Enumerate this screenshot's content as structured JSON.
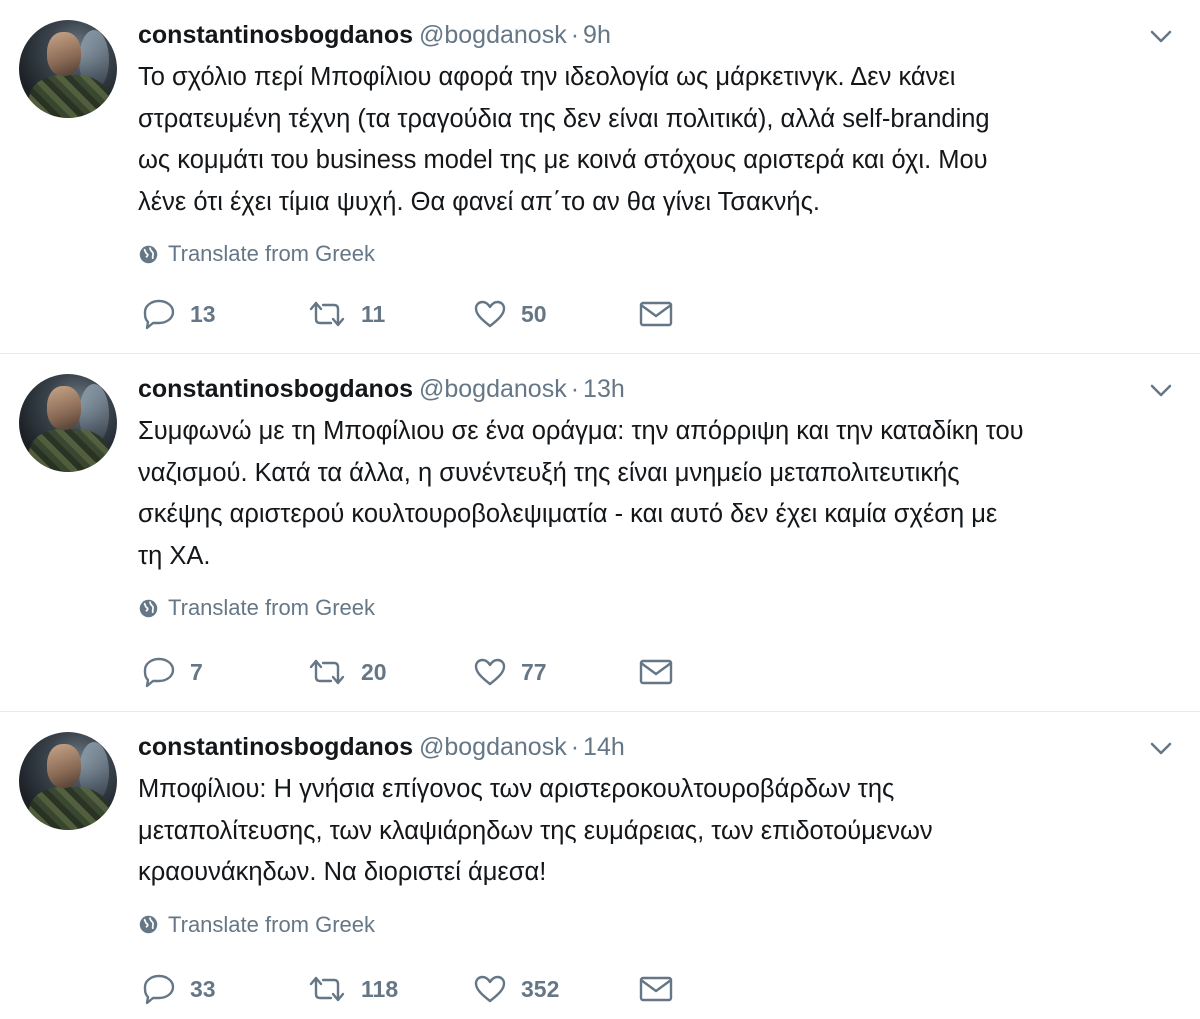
{
  "tweets": [
    {
      "display_name": "constantinosbogdanos",
      "handle": "@bogdanosk",
      "separator": "·",
      "time": "9h",
      "text": "Το σχόλιο περί Μποφίλιου αφορά την ιδεολογία ως μάρκετινγκ. Δεν κάνει\nστρατευμένη τέχνη (τα τραγούδια της δεν είναι πολιτικά), αλλά self-branding\nως κομμάτι του business model της με κοινά στόχους αριστερά και όχι. Μου\nλένε ότι έχει τίμια ψυχή. Θα φανεί απ΄το αν θα γίνει Τσακνής.",
      "translate_label": "Translate from Greek",
      "replies": "13",
      "retweets": "11",
      "likes": "50"
    },
    {
      "display_name": "constantinosbogdanos",
      "handle": "@bogdanosk",
      "separator": "·",
      "time": "13h",
      "text": "Συμφωνώ με τη Μποφίλιου σε ένα οράγμα: την απόρριψη και την καταδίκη του\nναζισμού. Κατά τα άλλα, η συνέντευξή της είναι μνημείο μεταπολιτευτικής\nσκέψης αριστερού κουλτουροβολεψιματία - και αυτό δεν έχει καμία σχέση με\nτη ΧΑ.",
      "translate_label": "Translate from Greek",
      "replies": "7",
      "retweets": "20",
      "likes": "77"
    },
    {
      "display_name": "constantinosbogdanos",
      "handle": "@bogdanosk",
      "separator": "·",
      "time": "14h",
      "text": "Μποφίλιου: Η γνήσια επίγονος των αριστεροκουλτουροβάρδων της\nμεταπολίτευσης, των κλαψιάρηδων της ευμάρειας, των επιδοτούμενων\nκραουνάκηδων. Να διοριστεί άμεσα!",
      "translate_label": "Translate from Greek",
      "replies": "33",
      "retweets": "118",
      "likes": "352"
    }
  ],
  "icons": {
    "reply": "reply-icon",
    "retweet": "retweet-icon",
    "like": "heart-icon",
    "dm": "envelope-icon",
    "more": "chevron-down-icon",
    "translate": "globe-icon"
  },
  "colors": {
    "text": "#14171a",
    "secondary": "#657786",
    "divider": "#e6ecf0"
  }
}
